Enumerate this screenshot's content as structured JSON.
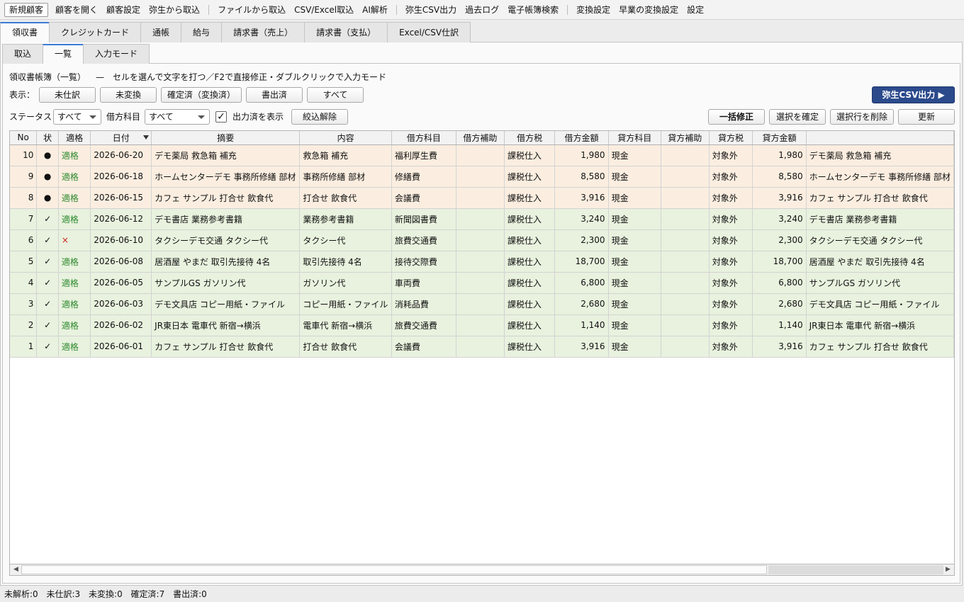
{
  "toolbar": {
    "items": [
      "新規顧客",
      "顧客を開く",
      "顧客設定",
      "弥生から取込",
      "ファイルから取込",
      "CSV/Excel取込",
      "AI解析",
      "弥生CSV出力",
      "過去ログ",
      "電子帳簿検索",
      "変換設定",
      "早業の変換設定",
      "設定"
    ]
  },
  "main_tabs": [
    "領収書",
    "クレジットカード",
    "通帳",
    "給与",
    "請求書（売上）",
    "請求書（支払）",
    "Excel/CSV仕訳"
  ],
  "sub_tabs": [
    "取込",
    "一覧",
    "入力モード"
  ],
  "header": {
    "title": "領収書帳簿（一覧）",
    "subtitle": "—　セルを選んで文字を打つ／F2で直接修正・ダブルクリックで入力モード"
  },
  "view_filter": {
    "label": "表示：",
    "buttons": [
      "未仕訳",
      "未変換",
      "確定済（変換済）",
      "書出済",
      "すべて"
    ]
  },
  "export_button": "弥生CSV出力 ▶",
  "filters": {
    "status_label": "ステータス",
    "status_value": "すべて",
    "debit_label": "借方科目",
    "debit_value": "すべて",
    "show_exported_checked": "✓",
    "show_exported_label": "出力済を表示",
    "clear_button": "絞込解除"
  },
  "actions": [
    "一括修正",
    "選択を確定",
    "選択行を削除",
    "更新"
  ],
  "table": {
    "columns": [
      "No",
      "状",
      "適格",
      "日付",
      "摘要",
      "内容",
      "借方科目",
      "借方補助",
      "借方税",
      "借方金額",
      "貸方科目",
      "貸方補助",
      "貸方税",
      "貸方金額",
      ""
    ],
    "rows": [
      {
        "state": "pending",
        "cells": [
          "10",
          "●",
          "適格",
          "2026-06-20",
          "デモ薬局 救急箱 補充",
          "救急箱 補充",
          "福利厚生費",
          "",
          "課税仕入",
          "1,980",
          "現金",
          "",
          "対象外",
          "1,980",
          "デモ薬局 救急箱 補充"
        ]
      },
      {
        "state": "pending",
        "cells": [
          "9",
          "●",
          "適格",
          "2026-06-18",
          "ホームセンターデモ 事務所修繕 部材",
          "事務所修繕 部材",
          "修繕費",
          "",
          "課税仕入",
          "8,580",
          "現金",
          "",
          "対象外",
          "8,580",
          "ホームセンターデモ 事務所修繕 部材"
        ]
      },
      {
        "state": "pending",
        "cells": [
          "8",
          "●",
          "適格",
          "2026-06-15",
          "カフェ サンプル 打合せ 飲食代",
          "打合せ 飲食代",
          "会議費",
          "",
          "課税仕入",
          "3,916",
          "現金",
          "",
          "対象外",
          "3,916",
          "カフェ サンプル 打合せ 飲食代"
        ]
      },
      {
        "state": "done",
        "cells": [
          "7",
          "✓",
          "適格",
          "2026-06-12",
          "デモ書店 業務参考書籍",
          "業務参考書籍",
          "新聞図書費",
          "",
          "課税仕入",
          "3,240",
          "現金",
          "",
          "対象外",
          "3,240",
          "デモ書店 業務参考書籍"
        ]
      },
      {
        "state": "done",
        "cells": [
          "6",
          "✓",
          "×",
          "2026-06-10",
          "タクシーデモ交通 タクシー代",
          "タクシー代",
          "旅費交通費",
          "",
          "課税仕入",
          "2,300",
          "現金",
          "",
          "対象外",
          "2,300",
          "タクシーデモ交通 タクシー代"
        ]
      },
      {
        "state": "done",
        "cells": [
          "5",
          "✓",
          "適格",
          "2026-06-08",
          "居酒屋 やまだ 取引先接待 4名",
          "取引先接待 4名",
          "接待交際費",
          "",
          "課税仕入",
          "18,700",
          "現金",
          "",
          "対象外",
          "18,700",
          "居酒屋 やまだ 取引先接待 4名"
        ]
      },
      {
        "state": "done",
        "cells": [
          "4",
          "✓",
          "適格",
          "2026-06-05",
          "サンプルGS ガソリン代",
          "ガソリン代",
          "車両費",
          "",
          "課税仕入",
          "6,800",
          "現金",
          "",
          "対象外",
          "6,800",
          "サンプルGS ガソリン代"
        ]
      },
      {
        "state": "done",
        "cells": [
          "3",
          "✓",
          "適格",
          "2026-06-03",
          "デモ文具店 コピー用紙・ファイル",
          "コピー用紙・ファイル",
          "消耗品費",
          "",
          "課税仕入",
          "2,680",
          "現金",
          "",
          "対象外",
          "2,680",
          "デモ文具店 コピー用紙・ファイル"
        ]
      },
      {
        "state": "done",
        "cells": [
          "2",
          "✓",
          "適格",
          "2026-06-02",
          "JR東日本 電車代 新宿→横浜",
          "電車代 新宿→横浜",
          "旅費交通費",
          "",
          "課税仕入",
          "1,140",
          "現金",
          "",
          "対象外",
          "1,140",
          "JR東日本 電車代 新宿→横浜"
        ]
      },
      {
        "state": "done",
        "cells": [
          "1",
          "✓",
          "適格",
          "2026-06-01",
          "カフェ サンプル 打合せ 飲食代",
          "打合せ 飲食代",
          "会議費",
          "",
          "課税仕入",
          "3,916",
          "現金",
          "",
          "対象外",
          "3,916",
          "カフェ サンプル 打合せ 飲食代"
        ]
      }
    ]
  },
  "scrollbar": {
    "left_arrow": "◀",
    "right_arrow": "▶"
  },
  "status_bar": [
    "未解析:0",
    "未仕訳:3",
    "未変換:0",
    "確定済:7",
    "書出済:0"
  ]
}
